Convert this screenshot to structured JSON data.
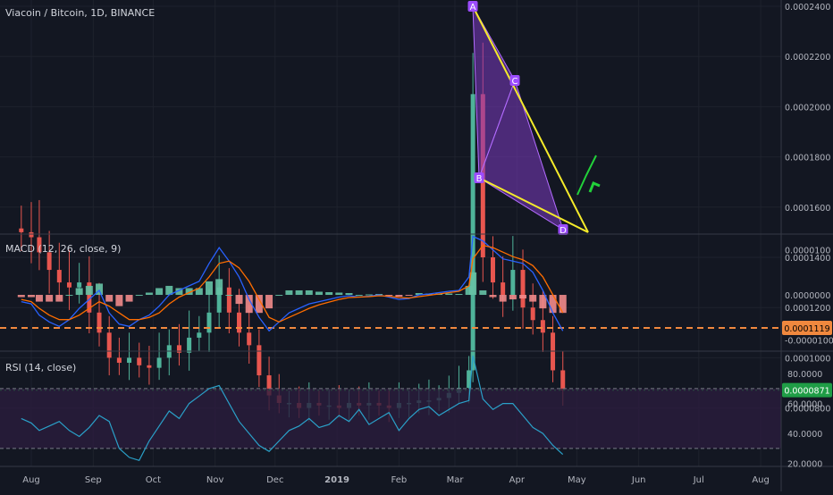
{
  "header": {
    "symbol_title": "Viacoin / Bitcoin, 1D, BINANCE",
    "macd_label": "MACD (12, 26, close, 9)",
    "rsi_label": "RSI (14, close)"
  },
  "colors": {
    "background": "#131722",
    "grid": "#1e222d",
    "candle_up": "#4fb39a",
    "candle_down": "#e8564f",
    "resistance": "#f0883e",
    "support": "#26c940",
    "pattern_fill": "#7b3bbf",
    "pattern_line": "#f5eb2a",
    "macd_line": "#2962ff",
    "signal_line": "#ff6d00",
    "rsi_line": "#2aa0c8",
    "rsi_band": "#2b1d3d",
    "arrow": "#22d13a"
  },
  "axis": {
    "x_ticks": [
      "Aug",
      "Sep",
      "Oct",
      "Nov",
      "Dec",
      "2019",
      "Feb",
      "Mar",
      "Apr",
      "May",
      "Jun",
      "Jul",
      "Aug"
    ],
    "price_ticks": [
      "0.0002400",
      "0.0002200",
      "0.0002000",
      "0.0001800",
      "0.0001600",
      "0.0001400",
      "0.0001200",
      "0.0001000",
      "0.0000800"
    ],
    "macd_ticks": [
      "0.0000100",
      "0.0000000",
      "-0.0000100"
    ],
    "rsi_ticks": [
      "80.0000",
      "60.0000",
      "40.0000",
      "20.0000"
    ]
  },
  "price_badges": {
    "resistance": "0.0001119",
    "current": "0.0000871"
  },
  "chart_data": [
    {
      "type": "candlestick",
      "pane": "price",
      "title": "Viacoin / Bitcoin, 1D, BINANCE",
      "x": [
        "2018-07-27",
        "2018-08-01",
        "2018-08-05",
        "2018-08-10",
        "2018-08-15",
        "2018-08-20",
        "2018-08-25",
        "2018-08-30",
        "2018-09-04",
        "2018-09-09",
        "2018-09-14",
        "2018-09-19",
        "2018-09-24",
        "2018-09-29",
        "2018-10-04",
        "2018-10-09",
        "2018-10-14",
        "2018-10-19",
        "2018-10-24",
        "2018-10-29",
        "2018-11-03",
        "2018-11-08",
        "2018-11-13",
        "2018-11-18",
        "2018-11-23",
        "2018-11-28",
        "2018-12-03",
        "2018-12-08",
        "2018-12-13",
        "2018-12-18",
        "2018-12-23",
        "2018-12-28",
        "2019-01-02",
        "2019-01-07",
        "2019-01-12",
        "2019-01-17",
        "2019-01-22",
        "2019-01-27",
        "2019-02-01",
        "2019-02-06",
        "2019-02-11",
        "2019-02-16",
        "2019-02-21",
        "2019-02-26",
        "2019-03-03",
        "2019-03-08",
        "2019-03-10",
        "2019-03-15",
        "2019-03-20",
        "2019-03-25",
        "2019-03-30",
        "2019-04-04",
        "2019-04-09",
        "2019-04-14",
        "2019-04-19",
        "2019-04-24"
      ],
      "close": [
        0.00015,
        0.000148,
        0.000142,
        0.000135,
        0.00013,
        0.000128,
        0.00013,
        0.000118,
        0.00011,
        0.0001,
        9.8e-05,
        0.0001,
        9.7e-05,
        9.6e-05,
        0.0001,
        0.000105,
        0.000102,
        0.000108,
        0.00011,
        0.000118,
        0.000128,
        0.000118,
        0.00011,
        0.000105,
        9.3e-05,
        8.5e-05,
        8.2e-05,
        8.2e-05,
        8e-05,
        8.2e-05,
        8.1e-05,
        8.1e-05,
        8e-05,
        8.2e-05,
        8.1e-05,
        8.2e-05,
        8.1e-05,
        8e-05,
        8.2e-05,
        8.2e-05,
        8.3e-05,
        8.3e-05,
        8.4e-05,
        8.6e-05,
        8.8e-05,
        9.5e-05,
        0.000205,
        0.00014,
        0.00013,
        0.000125,
        0.000135,
        0.00012,
        0.000115,
        0.00011,
        9.5e-05,
        8.7e-05
      ],
      "ylim": [
        7e-05,
        0.000241
      ]
    },
    {
      "type": "line",
      "pane": "macd",
      "title": "MACD (12, 26, close, 9)",
      "series": [
        {
          "name": "MACD",
          "values": [
            -1.5e-06,
            -2e-06,
            -4.5e-06,
            -6e-06,
            -7e-06,
            -5.5e-06,
            -3e-06,
            -1e-06,
            1e-06,
            -4e-06,
            -6.5e-06,
            -7e-06,
            -5.5e-06,
            -4.5e-06,
            -2.5e-06,
            0.0,
            1e-06,
            2e-06,
            3e-06,
            7e-06,
            1.05e-05,
            7.5e-06,
            4e-06,
            -1e-06,
            -5e-06,
            -8e-06,
            -6e-06,
            -4e-06,
            -3e-06,
            -2e-06,
            -1.5e-06,
            -1e-06,
            -5e-07,
            -2e-07,
            -5e-07,
            -3e-07,
            0.0,
            -5e-07,
            -1e-06,
            -8e-07,
            0.0,
            2e-07,
            5e-07,
            8e-07,
            1e-06,
            4e-06,
            1.3e-05,
            1.2e-05,
            1e-05,
            8e-06,
            7.5e-06,
            7e-06,
            5e-06,
            1e-06,
            -4e-06,
            -8e-06
          ]
        },
        {
          "name": "Signal",
          "values": [
            -1e-06,
            -1.5e-06,
            -3e-06,
            -4.5e-06,
            -5.5e-06,
            -5.5e-06,
            -4.5e-06,
            -3e-06,
            -1.5e-06,
            -2.5e-06,
            -4e-06,
            -5.5e-06,
            -5.5e-06,
            -5e-06,
            -4e-06,
            -2e-06,
            -5e-07,
            5e-07,
            1.5e-06,
            4e-06,
            7e-06,
            7.5e-06,
            6e-06,
            3e-06,
            -1e-06,
            -5e-06,
            -6e-06,
            -5e-06,
            -4e-06,
            -3e-06,
            -2.2e-06,
            -1.6e-06,
            -1e-06,
            -6e-07,
            -5e-07,
            -4e-07,
            -2e-07,
            -3e-07,
            -6e-07,
            -7e-07,
            -4e-07,
            -1e-07,
            2e-07,
            5e-07,
            8e-07,
            2e-06,
            8e-06,
            1.1e-05,
            1.05e-05,
            9.5e-06,
            8.5e-06,
            7.8e-06,
            6.5e-06,
            4e-06,
            0.0,
            -4e-06
          ]
        }
      ],
      "ylim": [
        -1.25e-05,
        1.35e-05
      ]
    },
    {
      "type": "line",
      "pane": "rsi",
      "title": "RSI (14, close)",
      "series": [
        {
          "name": "RSI",
          "values": [
            50,
            47,
            42,
            45,
            48,
            42,
            38,
            44,
            52,
            48,
            30,
            24,
            22,
            35,
            45,
            55,
            50,
            60,
            65,
            70,
            72,
            60,
            48,
            40,
            32,
            28,
            35,
            42,
            45,
            50,
            44,
            46,
            52,
            48,
            56,
            46,
            50,
            54,
            42,
            50,
            56,
            58,
            52,
            56,
            60,
            62,
            92,
            63,
            56,
            60,
            60,
            52,
            44,
            40,
            32,
            26
          ]
        }
      ],
      "ylim": [
        18,
        95
      ]
    }
  ]
}
